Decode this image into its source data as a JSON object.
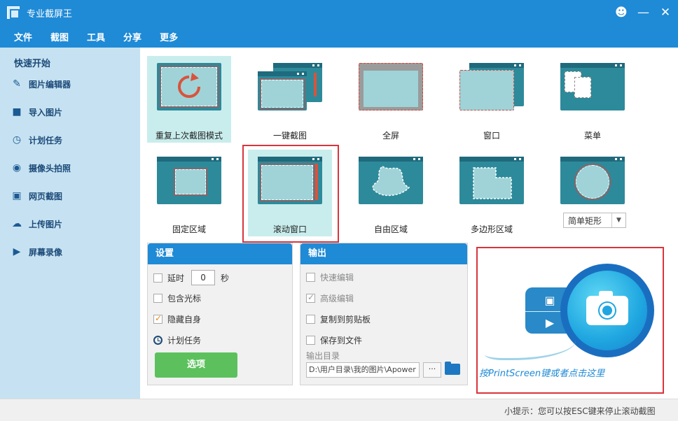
{
  "window": {
    "title": "专业截屏王"
  },
  "menu": [
    "文件",
    "截图",
    "工具",
    "分享",
    "更多"
  ],
  "sidebar": {
    "title": "快速开始",
    "items": [
      {
        "label": "图片编辑器",
        "icon": "pencil-icon"
      },
      {
        "label": "导入图片",
        "icon": "folder-open-icon"
      },
      {
        "label": "计划任务",
        "icon": "clock-icon"
      },
      {
        "label": "摄像头拍照",
        "icon": "webcam-icon"
      },
      {
        "label": "网页截图",
        "icon": "camera-icon"
      },
      {
        "label": "上传图片",
        "icon": "cloud-upload-icon"
      },
      {
        "label": "屏幕录像",
        "icon": "video-camera-icon"
      }
    ]
  },
  "modes": {
    "repeat": "重复上次截图模式",
    "oneclick": "一键截图",
    "fullscreen": "全屏",
    "window": "窗口",
    "menu": "菜单",
    "fixed": "固定区域",
    "scroll": "滚动窗口",
    "freeform": "自由区域",
    "polygon": "多边形区域"
  },
  "shape_select": {
    "value": "简单矩形"
  },
  "settings": {
    "title": "设置",
    "delay_label": "延时",
    "delay_value": "0",
    "delay_unit": "秒",
    "include_cursor": "包含光标",
    "hide_self": "隐藏自身",
    "schedule": "计划任务",
    "options_button": "选项"
  },
  "output": {
    "title": "输出",
    "quick_edit": "快速编辑",
    "advanced_edit": "高级编辑",
    "copy_clipboard": "复制到剪贴板",
    "save_file": "保存到文件",
    "dir_label": "输出目录",
    "dir_value": "D:\\用户目录\\我的图片\\Apower",
    "browse": "···"
  },
  "capture": {
    "hint": "按PrintScreen键或者点击这里"
  },
  "status": {
    "text": "小提示：您可以按ESC键来停止滚动截图"
  },
  "colors": {
    "accent": "#1f8ad6",
    "highlight": "#d9343c",
    "selected_tile": "#c9eded",
    "options_green": "#5cc15c"
  }
}
